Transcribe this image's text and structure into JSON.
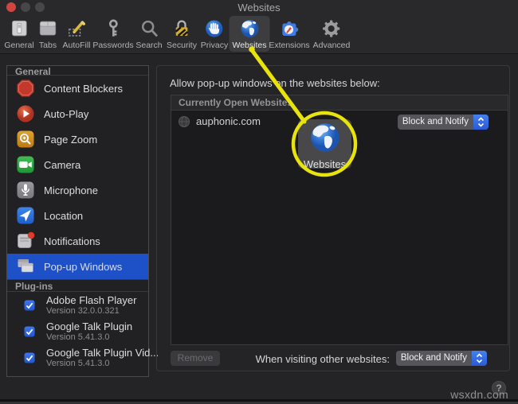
{
  "window": {
    "title": "Websites"
  },
  "toolbar": {
    "items": [
      {
        "label": "General"
      },
      {
        "label": "Tabs"
      },
      {
        "label": "AutoFill"
      },
      {
        "label": "Passwords"
      },
      {
        "label": "Search"
      },
      {
        "label": "Security"
      },
      {
        "label": "Privacy"
      },
      {
        "label": "Websites"
      },
      {
        "label": "Extensions"
      },
      {
        "label": "Advanced"
      }
    ]
  },
  "sidebar": {
    "general_header": "General",
    "items": [
      {
        "label": "Content Blockers"
      },
      {
        "label": "Auto-Play"
      },
      {
        "label": "Page Zoom"
      },
      {
        "label": "Camera"
      },
      {
        "label": "Microphone"
      },
      {
        "label": "Location"
      },
      {
        "label": "Notifications"
      },
      {
        "label": "Pop-up Windows"
      }
    ],
    "plugins_header": "Plug-ins",
    "plugins": [
      {
        "label": "Adobe Flash Player",
        "version": "Version 32.0.0.321"
      },
      {
        "label": "Google Talk Plugin",
        "version": "Version 5.41.3.0"
      },
      {
        "label": "Google Talk Plugin Vid...",
        "version": "Version 5.41.3.0"
      }
    ]
  },
  "main": {
    "intro": "Allow pop-up windows on the websites below:",
    "list_header": "Currently Open Websites",
    "rows": [
      {
        "site": "auphonic.com",
        "policy": "Block and Notify"
      }
    ],
    "remove_label": "Remove",
    "other_label": "When visiting other websites:",
    "other_policy": "Block and Notify",
    "help_label": "?"
  },
  "callout": {
    "label": "Websites",
    "color": "#e8e30c"
  },
  "watermark": "wsxdn.com"
}
